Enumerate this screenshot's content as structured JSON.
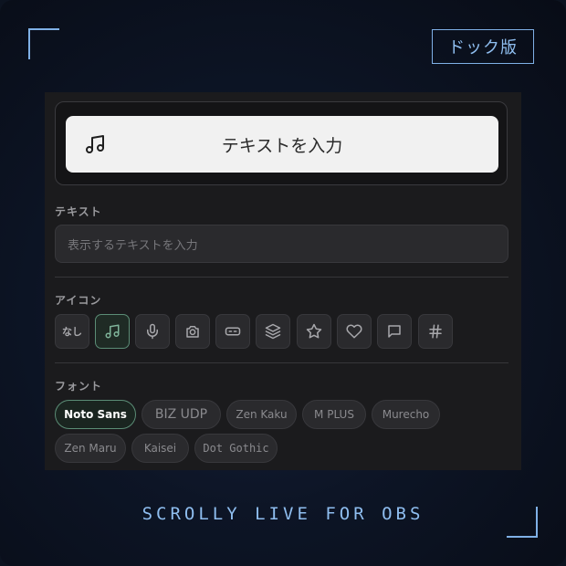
{
  "badge": {
    "label": "ドック版"
  },
  "preview": {
    "icon": "music-note-icon",
    "text": "テキストを入力"
  },
  "text_section": {
    "label": "テキスト",
    "placeholder": "表示するテキストを入力"
  },
  "icon_section": {
    "label": "アイコン",
    "none_label": "なし",
    "icons": [
      "none",
      "music-note-icon",
      "microphone-icon",
      "camera-icon",
      "gamepad-icon",
      "layers-icon",
      "star-icon",
      "heart-icon",
      "chat-bubble-icon",
      "hash-icon"
    ],
    "selected": "music-note-icon"
  },
  "font_section": {
    "label": "フォント",
    "fonts": [
      "Noto Sans",
      "BIZ UDP",
      "Zen Kaku",
      "M PLUS",
      "Murecho",
      "Zen Maru",
      "Kaisei",
      "Dot Gothic"
    ],
    "selected": "Noto Sans"
  },
  "footer": {
    "title": "SCROLLY LIVE FOR OBS"
  },
  "colors": {
    "accent_blue": "#8fbef0",
    "selected_green": "#5b8d76",
    "panel_bg": "#1b1b1d"
  }
}
